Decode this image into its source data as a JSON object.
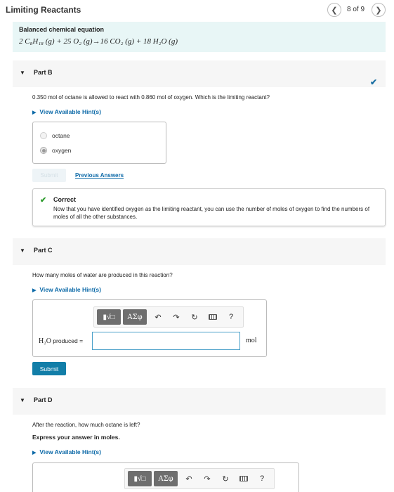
{
  "header": {
    "title": "Limiting Reactants",
    "page_indicator": "8 of 9",
    "prev_icon": "chevron-left-icon",
    "next_icon": "chevron-right-icon"
  },
  "equation": {
    "label": "Balanced chemical equation",
    "text": "2 C₈H₁₈ (g) + 25 O₂ (g)→16 CO₂ (g) + 18 H₂O (g)"
  },
  "partB": {
    "title": "Part B",
    "question": "0.350 mol of octane is allowed to react with 0.860 mol of oxygen. Which is the limiting reactant?",
    "hint_label": "View Available Hint(s)",
    "choices": [
      "octane",
      "oxygen"
    ],
    "selected_choice": "oxygen",
    "submit_label": "Submit",
    "previous_answers_label": "Previous Answers",
    "feedback_title": "Correct",
    "feedback_text": "Now that you have identified oxygen as the limiting reactant, you can use the number of moles of oxygen to find the numbers of moles of all the other substances.",
    "status": "complete"
  },
  "partC": {
    "title": "Part C",
    "question": "How many moles of water are produced in this reaction?",
    "hint_label": "View Available Hint(s)",
    "toolbar_greek": "ΑΣφ",
    "help_label": "?",
    "answer_label_chem": "H₂O",
    "answer_label_suffix": " produced =",
    "answer_value": "",
    "unit": "mol",
    "submit_label": "Submit"
  },
  "partD": {
    "title": "Part D",
    "question": "After the reaction, how much octane is left?",
    "instruction": "Express your answer in moles.",
    "hint_label": "View Available Hint(s)",
    "toolbar_greek": "ΑΣφ",
    "help_label": "?"
  },
  "colors": {
    "accent": "#127ea8",
    "link": "#0d6aa8",
    "correct": "#2a9a2a",
    "equation_bg": "#e8f6f6"
  }
}
